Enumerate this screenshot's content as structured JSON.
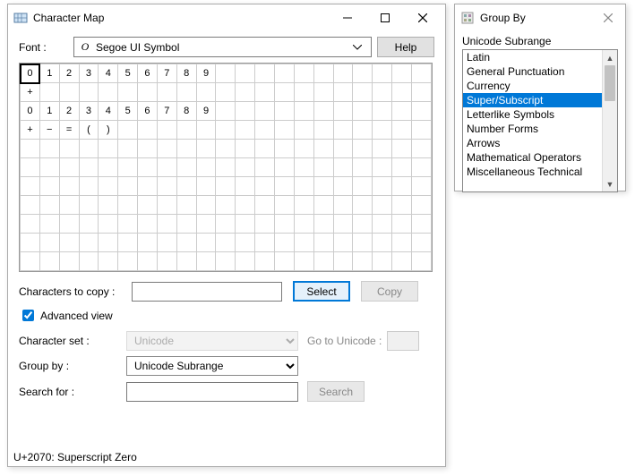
{
  "main": {
    "title": "Character Map",
    "font_label": "Font :",
    "font_icon": "O",
    "font_name": "Segoe UI Symbol",
    "help_btn": "Help",
    "grid_cols": 21,
    "grid_rows": 11,
    "selected_index": 0,
    "chars_row1": [
      "0",
      "1",
      "2",
      "3",
      "4",
      "5",
      "6",
      "7",
      "8",
      "9"
    ],
    "chars_row2": [
      "+"
    ],
    "chars_row3": [
      "0",
      "1",
      "2",
      "3",
      "4",
      "5",
      "6",
      "7",
      "8",
      "9"
    ],
    "chars_row4": [
      "+",
      "−",
      "=",
      "(",
      ")"
    ],
    "copy_label": "Characters to copy :",
    "copy_value": "",
    "select_btn": "Select",
    "copy_btn": "Copy",
    "adv_label": "Advanced view",
    "adv_checked": true,
    "charset_label": "Character set :",
    "charset_value": "Unicode",
    "goto_label": "Go to Unicode :",
    "goto_value": "",
    "groupby_label": "Group by :",
    "groupby_value": "Unicode Subrange",
    "search_label": "Search for :",
    "search_value": "",
    "search_btn": "Search",
    "status": "U+2070: Superscript Zero"
  },
  "popup": {
    "title": "Group By",
    "header": "Unicode Subrange",
    "selected": 3,
    "items": [
      "Latin",
      "General Punctuation",
      "Currency",
      "Super/Subscript",
      "Letterlike Symbols",
      "Number Forms",
      "Arrows",
      "Mathematical Operators",
      "Miscellaneous Technical"
    ]
  }
}
